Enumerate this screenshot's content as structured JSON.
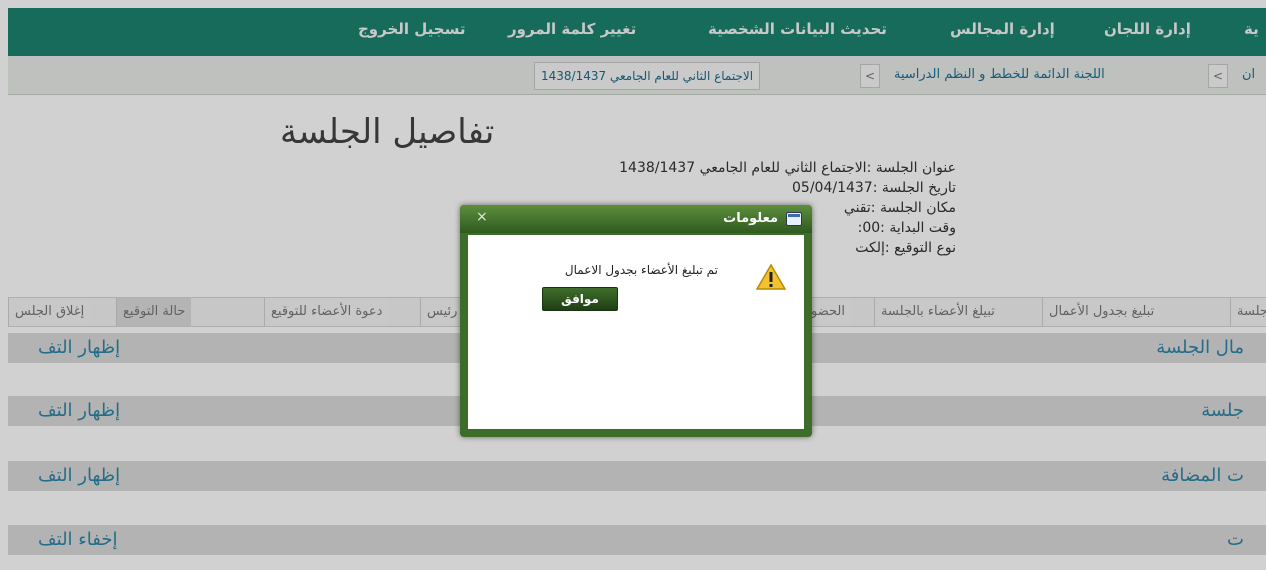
{
  "topnav": {
    "items": [
      "تسجيل الخروج",
      "تغيير كلمة المرور",
      "تحديث البيانات الشخصية",
      "إدارة المجالس",
      "إدارة اللجان",
      "ية"
    ]
  },
  "breadcrumb": {
    "items": [
      "ان",
      "اللجنة الدائمة للخطط و النظم الدراسية",
      "الاجتماع الثاني للعام الجامعي 1438/1437"
    ],
    "separator": ">"
  },
  "page": {
    "title": "تفاصيل الجلسة"
  },
  "session_info": [
    "عنوان الجلسة :الاجتماع الثاني للعام الجامعي 1438/1437",
    "تاريخ الجلسة :05/04/1437",
    "مكان الجلسة :تقني",
    "وقت البداية :00:",
    "نوع التوقيع :إلكت"
  ],
  "tabs": [
    "جلسة",
    "تبليغ بجدول الأعمال",
    "تبيلغ الأعضاء بالجلسة",
    "الحضو",
    "رئيس",
    "دعوة الأعضاء للتوقيع",
    "حالة التوقيع",
    "إغلاق الجلس"
  ],
  "sections": [
    {
      "title": "مال الجلسة",
      "toggle": "إظهار التف"
    },
    {
      "title": "جلسة",
      "toggle": "إظهار التف"
    },
    {
      "title": "ت المضافة",
      "toggle": "إظهار التف"
    },
    {
      "title": "ت",
      "toggle": "إخفاء التف"
    }
  ],
  "dialog": {
    "title": "معلومات",
    "close": "×",
    "message": "تم تبليغ الأعضاء بجدول الاعمال",
    "ok_label": "موافق"
  },
  "colors": {
    "nav_bg": "#1b8370",
    "dialog_frame": "#3d6d29",
    "link": "#2c86a8"
  }
}
